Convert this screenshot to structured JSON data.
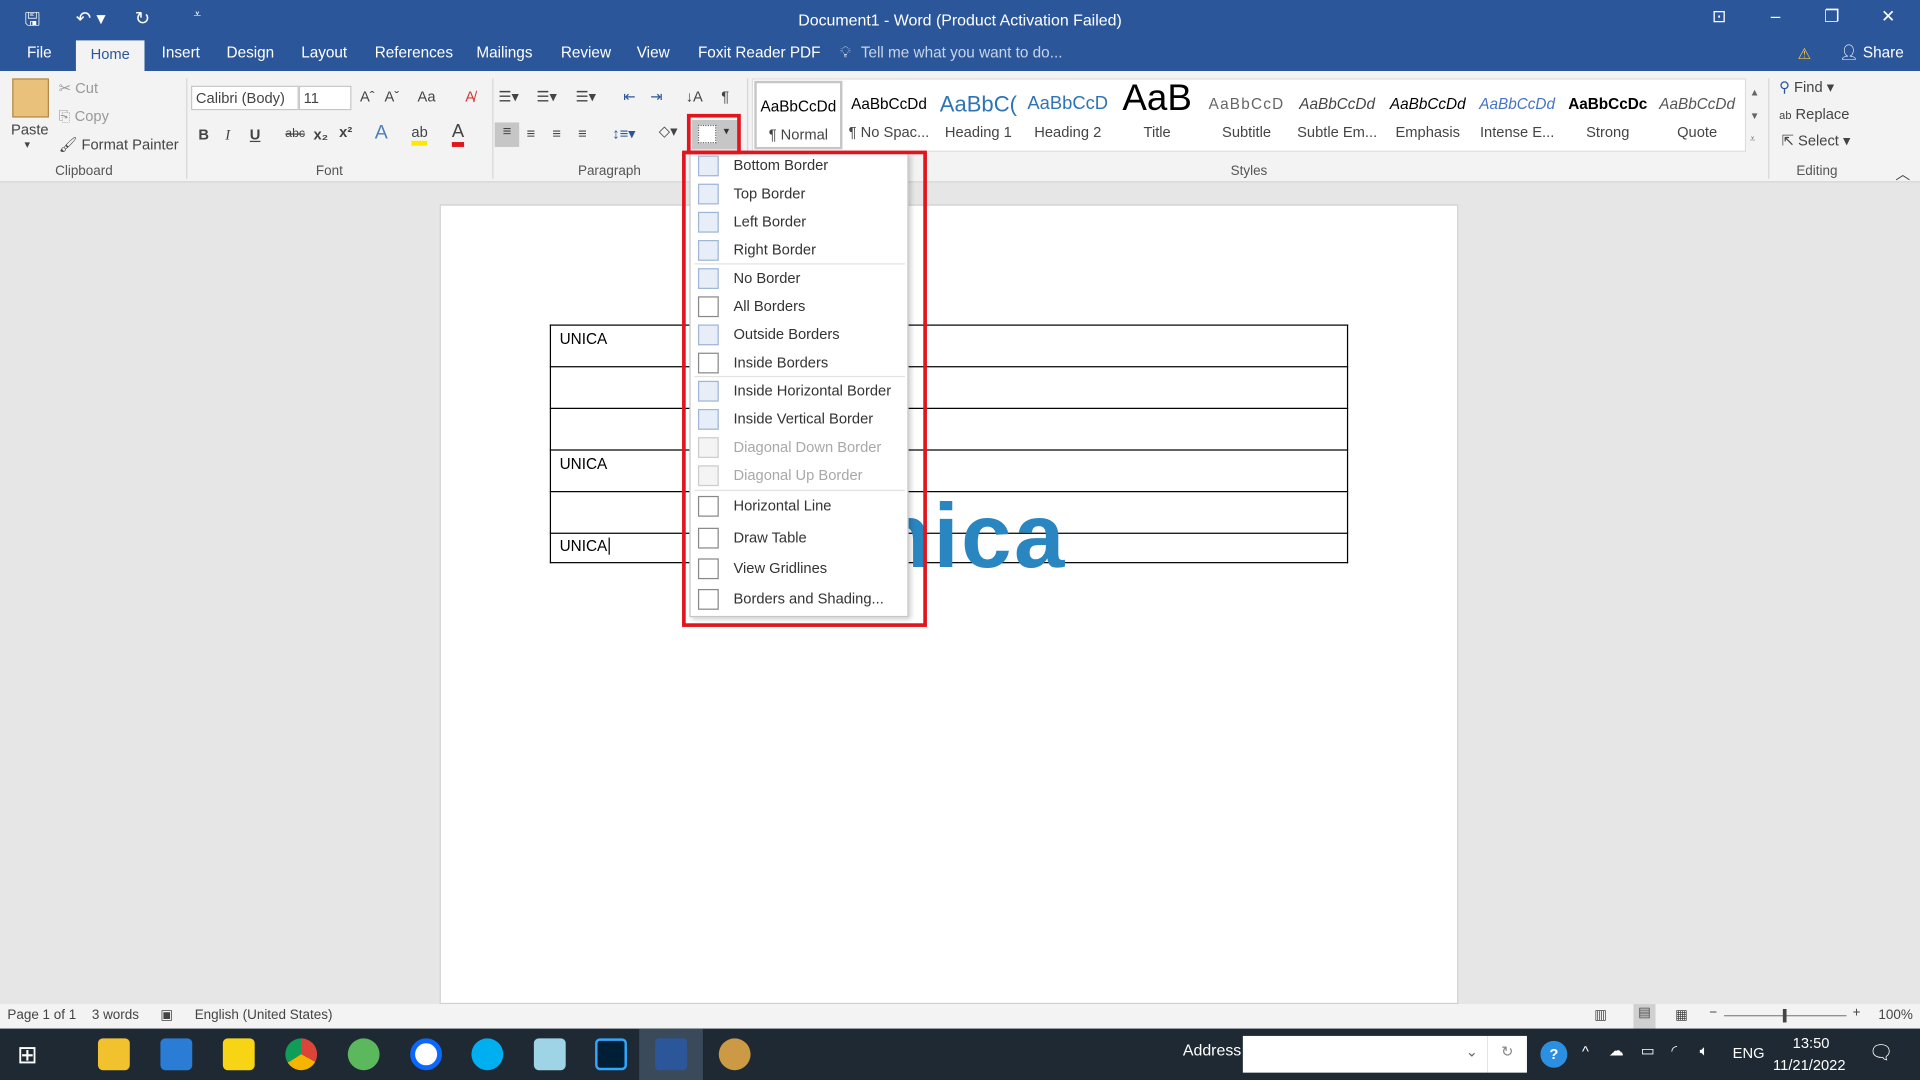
{
  "window": {
    "title": "Document1 - Word (Product Activation Failed)",
    "share": "Share",
    "tell_me": "Tell me what you want to do..."
  },
  "tabs": [
    "File",
    "Home",
    "Insert",
    "Design",
    "Layout",
    "References",
    "Mailings",
    "Review",
    "View",
    "Foxit Reader PDF"
  ],
  "clipboard": {
    "paste": "Paste",
    "cut": "Cut",
    "copy": "Copy",
    "format_painter": "Format Painter",
    "label": "Clipboard"
  },
  "font": {
    "name": "Calibri (Body)",
    "size": "11",
    "label": "Font",
    "case": "Aa",
    "bold": "B",
    "italic": "I",
    "underline": "U",
    "strike": "abc",
    "sub": "x₂",
    "sup": "x²"
  },
  "paragraph": {
    "label": "Paragraph",
    "pilcrow": "¶"
  },
  "styles": {
    "label": "Styles",
    "items": [
      {
        "preview": "AaBbCcDd",
        "name": "¶ Normal"
      },
      {
        "preview": "AaBbCcDd",
        "name": "¶ No Spac..."
      },
      {
        "preview": "AaBbC(",
        "name": "Heading 1"
      },
      {
        "preview": "AaBbCcD",
        "name": "Heading 2"
      },
      {
        "preview": "AaB",
        "name": "Title"
      },
      {
        "preview": "AaBbCcD",
        "name": "Subtitle"
      },
      {
        "preview": "AaBbCcDd",
        "name": "Subtle Em..."
      },
      {
        "preview": "AaBbCcDd",
        "name": "Emphasis"
      },
      {
        "preview": "AaBbCcDd",
        "name": "Intense E..."
      },
      {
        "preview": "AaBbCcDc",
        "name": "Strong"
      },
      {
        "preview": "AaBbCcDd",
        "name": "Quote"
      }
    ]
  },
  "editing": {
    "label": "Editing",
    "find": "Find",
    "replace": "Replace",
    "select": "Select"
  },
  "table": {
    "rows": [
      [
        "UNICA",
        ""
      ],
      [
        "",
        ""
      ],
      [
        "",
        ""
      ],
      [
        "UNICA",
        ""
      ],
      [
        "",
        ""
      ],
      [
        "UNICA",
        ""
      ]
    ]
  },
  "borders_menu": {
    "items": [
      {
        "label": "Bottom Border",
        "enabled": true
      },
      {
        "label": "Top Border",
        "enabled": true
      },
      {
        "label": "Left Border",
        "enabled": true
      },
      {
        "label": "Right Border",
        "enabled": true
      },
      {
        "label": "No Border",
        "enabled": true
      },
      {
        "label": "All Borders",
        "enabled": true
      },
      {
        "label": "Outside Borders",
        "enabled": true
      },
      {
        "label": "Inside Borders",
        "enabled": true
      },
      {
        "label": "Inside Horizontal Border",
        "enabled": true
      },
      {
        "label": "Inside Vertical Border",
        "enabled": true
      },
      {
        "label": "Diagonal Down Border",
        "enabled": false
      },
      {
        "label": "Diagonal Up Border",
        "enabled": false
      },
      {
        "label": "Horizontal Line",
        "enabled": true
      },
      {
        "label": "Draw Table",
        "enabled": true
      },
      {
        "label": "View Gridlines",
        "enabled": true
      },
      {
        "label": "Borders and Shading...",
        "enabled": true
      }
    ]
  },
  "watermark": {
    "text": "unica",
    "colors": {
      "u": "#f39a2e",
      "rest": "#2a86c0"
    }
  },
  "status": {
    "page": "Page 1 of 1",
    "words": "3 words",
    "language": "English (United States)",
    "zoom": "100%"
  },
  "taskbar": {
    "address_label": "Address",
    "time": "13:50",
    "date": "11/21/2022",
    "lang": "ENG"
  },
  "colors": {
    "accent": "#2b579a",
    "highlight": "#e0151e"
  }
}
